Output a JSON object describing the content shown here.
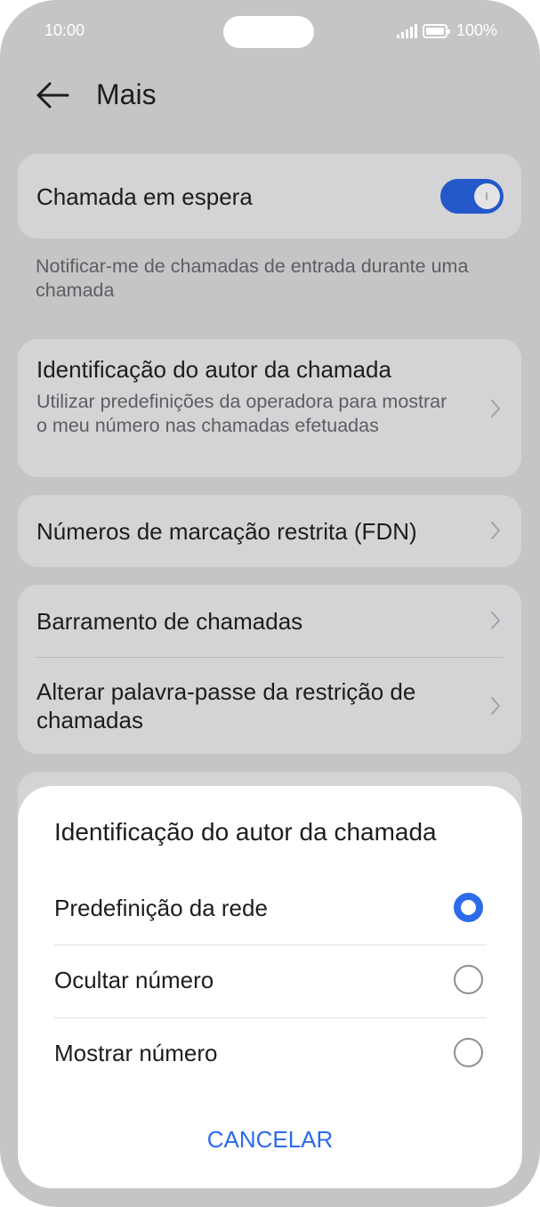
{
  "status_bar": {
    "time": "10:00",
    "battery": "100%"
  },
  "header": {
    "title": "Mais"
  },
  "call_waiting": {
    "label": "Chamada em espera",
    "enabled": true,
    "description": "Notificar-me de chamadas de entrada durante uma chamada"
  },
  "caller_id": {
    "title": "Identificação do autor da chamada",
    "subtitle": "Utilizar predefinições da operadora para mostrar o meu número nas chamadas efetuadas"
  },
  "fdn": {
    "title": "Números de marcação restrita (FDN)"
  },
  "barring": {
    "title": "Barramento de chamadas",
    "change_password": "Alterar palavra-passe da restrição de chamadas"
  },
  "dialog": {
    "title": "Identificação do autor da chamada",
    "options": [
      {
        "label": "Predefinição da rede",
        "selected": true
      },
      {
        "label": "Ocultar número",
        "selected": false
      },
      {
        "label": "Mostrar número",
        "selected": false
      }
    ],
    "cancel_label": "CANCELAR"
  },
  "colors": {
    "accent": "#2c6bea",
    "toggle_on": "#2458c9",
    "scrim_background": "#c5c5c7"
  }
}
